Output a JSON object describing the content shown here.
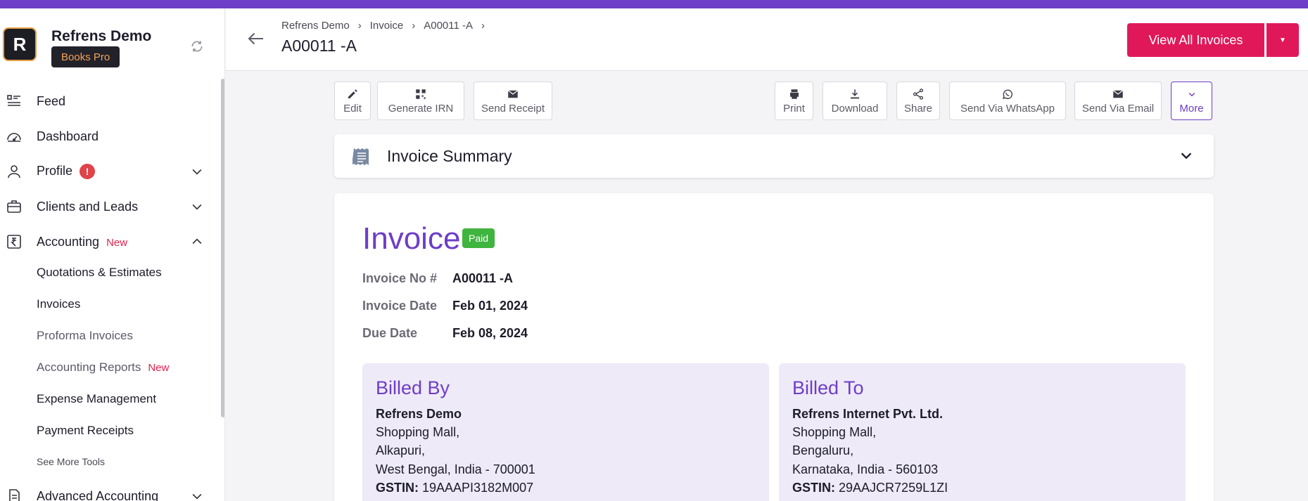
{
  "brand": {
    "initial": "R",
    "name": "Refrens Demo",
    "plan": "Books Pro"
  },
  "nav": {
    "feed": "Feed",
    "dashboard": "Dashboard",
    "profile": "Profile",
    "profile_alert": "!",
    "clients": "Clients and Leads",
    "accounting": "Accounting",
    "new_tag": "New",
    "accounting_items": [
      "Quotations & Estimates",
      "Invoices",
      "Proforma Invoices",
      "Accounting Reports",
      "Expense Management",
      "Payment Receipts"
    ],
    "see_more": "See More Tools",
    "advanced": "Advanced Accounting"
  },
  "header": {
    "breadcrumbs": [
      "Refrens Demo",
      "Invoice",
      "A00011 -A"
    ],
    "title": "A00011 -A",
    "primary_button": "View All Invoices"
  },
  "toolbar": {
    "edit": "Edit",
    "generate_irn": "Generate IRN",
    "send_receipt": "Send Receipt",
    "print": "Print",
    "download": "Download",
    "share": "Share",
    "send_whatsapp": "Send Via WhatsApp",
    "send_email": "Send Via Email",
    "more": "More"
  },
  "summary": {
    "title": "Invoice Summary"
  },
  "invoice": {
    "title": "Invoice",
    "status": "Paid",
    "no_label": "Invoice No #",
    "no_value": "A00011 -A",
    "date_label": "Invoice Date",
    "date_value": "Feb 01, 2024",
    "due_label": "Due Date",
    "due_value": "Feb 08, 2024"
  },
  "billed_by": {
    "title": "Billed By",
    "name": "Refrens Demo",
    "line1": "Shopping Mall,",
    "line2": "Alkapuri,",
    "line3": "West Bengal, India - 700001",
    "gstin_label": "GSTIN:",
    "gstin": "19AAAPI3182M007"
  },
  "billed_to": {
    "title": "Billed To",
    "name": "Refrens Internet Pvt. Ltd.",
    "line1": "Shopping Mall,",
    "line2": "Bengaluru,",
    "line3": "Karnataka, India - 560103",
    "gstin_label": "GSTIN:",
    "gstin": "29AAJCR7259L1ZI"
  },
  "colors": {
    "brand_purple": "#6d3ec7",
    "primary_pink": "#e0185a",
    "paid_green": "#3fb43f"
  }
}
